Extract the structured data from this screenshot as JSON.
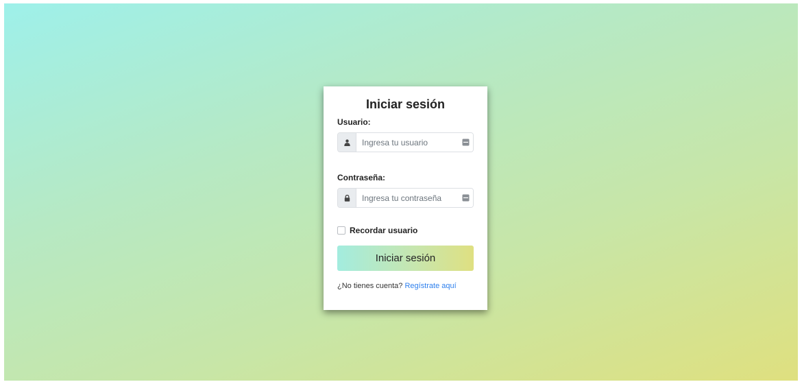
{
  "login": {
    "title": "Iniciar sesión",
    "username": {
      "label": "Usuario:",
      "placeholder": "Ingresa tu usuario",
      "value": "",
      "icon": "user-icon"
    },
    "password": {
      "label": "Contraseña:",
      "placeholder": "Ingresa tu contraseña",
      "value": "",
      "icon": "lock-icon"
    },
    "remember": {
      "label": "Recordar usuario",
      "checked": false
    },
    "submit_label": "Iniciar sesión",
    "signup": {
      "prompt": "¿No tienes cuenta?",
      "link_text": "Regístrate aquí"
    }
  },
  "colors": {
    "background_start": "#9ef0ea",
    "background_end": "#dfe07f",
    "link": "#2f80ed",
    "card": "#ffffff"
  }
}
